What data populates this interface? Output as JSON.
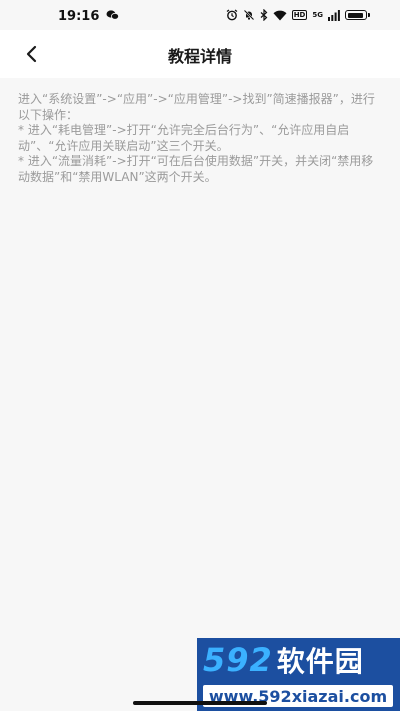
{
  "status_bar": {
    "time": "19:16",
    "hd_label": "HD",
    "signal_label": "5G"
  },
  "nav": {
    "title": "教程详情",
    "back_icon": "chevron-left-icon"
  },
  "content": {
    "paragraph1": "进入“系统设置”->“应用”->“应用管理”->找到”简速播报器”，进行以下操作：",
    "paragraph2": "* 进入“耗电管理”->打开“允许完全后台行为”、“允许应用自启动”、“允许应用关联启动”这三个开关。",
    "paragraph3": "* 进入“流量消耗”->打开“可在后台使用数据”开关，并关闭“禁用移动数据”和“禁用WLAN”这两个开关。"
  },
  "watermark": {
    "digits": "592",
    "name": "软件园",
    "url": "www.592xiazai.com"
  },
  "colors": {
    "background": "#f7f7f7",
    "navbar": "#ffffff",
    "body_text": "#9b9b9b",
    "watermark_bg": "#1c4fa0",
    "watermark_digits": "#3bb1ff"
  }
}
